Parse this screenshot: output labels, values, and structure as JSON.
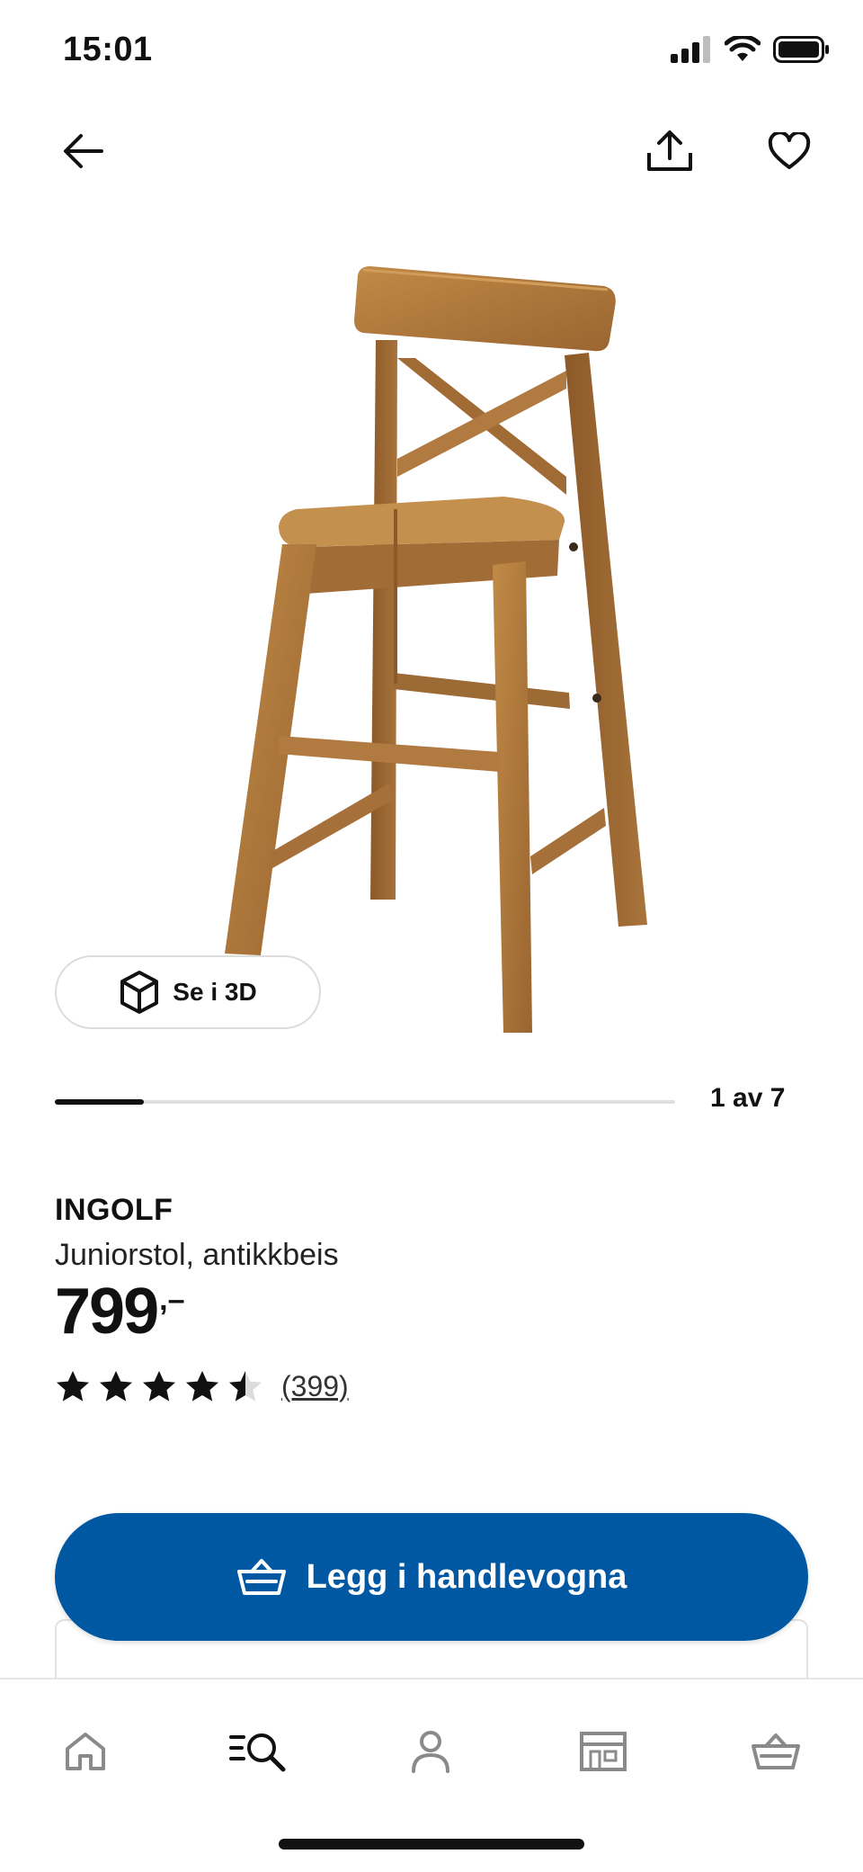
{
  "status_bar": {
    "time": "15:01",
    "icons": [
      "cellular-signal-icon",
      "wifi-icon",
      "battery-icon"
    ]
  },
  "nav": {
    "back_icon": "arrow-left-icon",
    "share_icon": "share-icon",
    "favorite_icon": "heart-icon"
  },
  "gallery": {
    "image_subject": "wooden junior chair",
    "view_3d_label": "Se i 3D",
    "view_3d_icon": "cube-icon",
    "current": 1,
    "total": 7,
    "progress_text": "1 av 7",
    "progress_fraction": 0.142857
  },
  "product": {
    "name": "INGOLF",
    "description": "Juniorstol, antikkbeis",
    "price": "799",
    "price_suffix": ",–",
    "rating_value": 4.5,
    "rating_max": 5,
    "review_count": "(399)"
  },
  "cta": {
    "label": "Legg i handlevogna",
    "icon": "basket-icon",
    "color": "#0058a3"
  },
  "tabbar": {
    "items": [
      {
        "name": "home",
        "icon": "home-icon",
        "active": false
      },
      {
        "name": "search",
        "icon": "search-icon",
        "active": true
      },
      {
        "name": "profile",
        "icon": "person-icon",
        "active": false
      },
      {
        "name": "stores",
        "icon": "store-icon",
        "active": false
      },
      {
        "name": "cart",
        "icon": "cart-icon",
        "active": false
      }
    ]
  },
  "colors": {
    "accent": "#0058a3",
    "inactive_icon": "#8a8a8a",
    "text": "#111111"
  }
}
